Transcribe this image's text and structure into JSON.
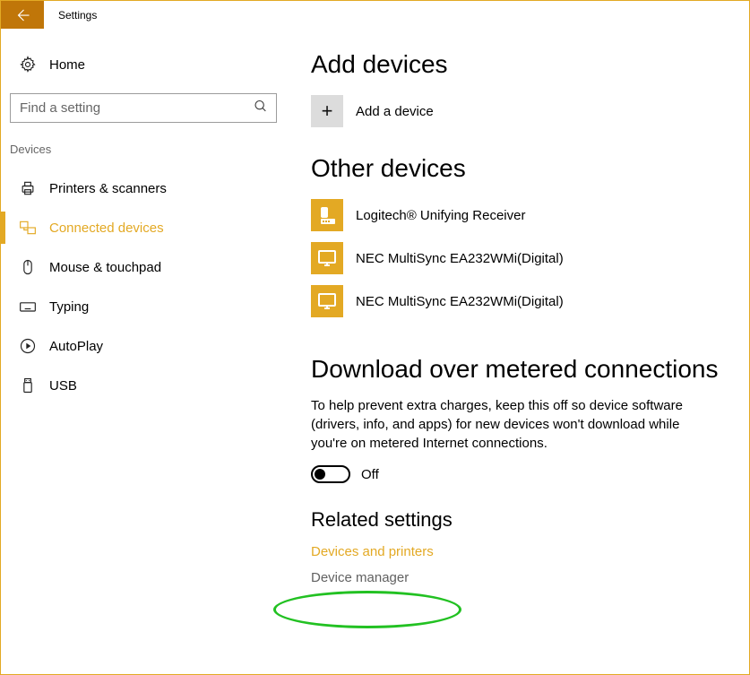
{
  "title": "Settings",
  "colors": {
    "accent": "#e3a924",
    "back_btn": "#c07609"
  },
  "sidebar": {
    "home_label": "Home",
    "search_placeholder": "Find a setting",
    "section_label": "Devices",
    "items": [
      {
        "label": "Printers & scanners",
        "icon": "printer-icon",
        "selected": false
      },
      {
        "label": "Connected devices",
        "icon": "connected-devices-icon",
        "selected": true
      },
      {
        "label": "Mouse & touchpad",
        "icon": "mouse-icon",
        "selected": false
      },
      {
        "label": "Typing",
        "icon": "keyboard-icon",
        "selected": false
      },
      {
        "label": "AutoPlay",
        "icon": "autoplay-icon",
        "selected": false
      },
      {
        "label": "USB",
        "icon": "usb-icon",
        "selected": false
      }
    ]
  },
  "main": {
    "add_heading": "Add devices",
    "add_button_label": "Add a device",
    "other_heading": "Other devices",
    "devices": [
      {
        "name": "Logitech® Unifying Receiver",
        "icon": "receiver-icon"
      },
      {
        "name": "NEC MultiSync EA232WMi(Digital)",
        "icon": "monitor-icon"
      },
      {
        "name": "NEC MultiSync EA232WMi(Digital)",
        "icon": "monitor-icon"
      }
    ],
    "metered_heading": "Download over metered connections",
    "metered_desc": "To help prevent extra charges, keep this off so device software (drivers, info, and apps) for new devices won't download while you're on metered Internet connections.",
    "toggle_state": "Off",
    "related_heading": "Related settings",
    "related_links": [
      {
        "label": "Devices and printers",
        "highlight": true
      },
      {
        "label": "Device manager",
        "highlight": false
      }
    ]
  }
}
